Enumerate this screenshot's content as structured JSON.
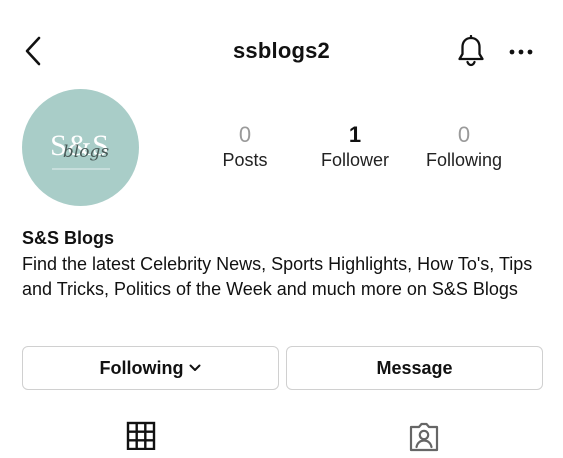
{
  "header": {
    "username": "ssblogs2",
    "back_icon": "chevron-left-icon",
    "bell_icon": "bell-icon",
    "more_icon": "more-horizontal-icon"
  },
  "avatar": {
    "logo_text": "S&S",
    "script_text": "blogs",
    "background_color": "#a9cdc8"
  },
  "stats": {
    "posts": {
      "count": "0",
      "label": "Posts"
    },
    "followers": {
      "count": "1",
      "label": "Follower"
    },
    "following": {
      "count": "0",
      "label": "Following"
    }
  },
  "bio": {
    "name": "S&S Blogs",
    "text": "Find the latest Celebrity News, Sports Highlights, How To's, Tips and Tricks, Politics of the Week and much more on S&S Blogs"
  },
  "actions": {
    "following_label": "Following",
    "message_label": "Message"
  },
  "tabs": {
    "grid_icon": "grid-icon",
    "tagged_icon": "tagged-user-icon"
  }
}
